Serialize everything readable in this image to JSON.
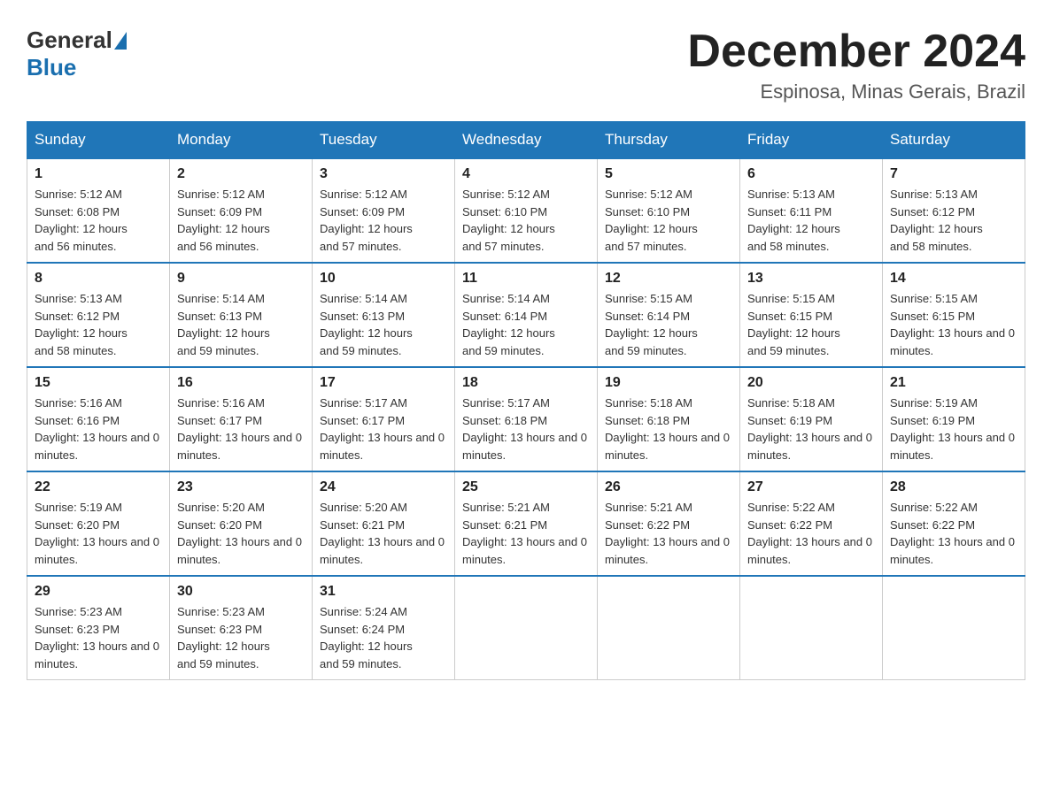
{
  "logo": {
    "general": "General",
    "blue": "Blue"
  },
  "header": {
    "month_year": "December 2024",
    "location": "Espinosa, Minas Gerais, Brazil"
  },
  "weekdays": [
    "Sunday",
    "Monday",
    "Tuesday",
    "Wednesday",
    "Thursday",
    "Friday",
    "Saturday"
  ],
  "weeks": [
    [
      {
        "day": "1",
        "sunrise": "5:12 AM",
        "sunset": "6:08 PM",
        "daylight": "12 hours and 56 minutes."
      },
      {
        "day": "2",
        "sunrise": "5:12 AM",
        "sunset": "6:09 PM",
        "daylight": "12 hours and 56 minutes."
      },
      {
        "day": "3",
        "sunrise": "5:12 AM",
        "sunset": "6:09 PM",
        "daylight": "12 hours and 57 minutes."
      },
      {
        "day": "4",
        "sunrise": "5:12 AM",
        "sunset": "6:10 PM",
        "daylight": "12 hours and 57 minutes."
      },
      {
        "day": "5",
        "sunrise": "5:12 AM",
        "sunset": "6:10 PM",
        "daylight": "12 hours and 57 minutes."
      },
      {
        "day": "6",
        "sunrise": "5:13 AM",
        "sunset": "6:11 PM",
        "daylight": "12 hours and 58 minutes."
      },
      {
        "day": "7",
        "sunrise": "5:13 AM",
        "sunset": "6:12 PM",
        "daylight": "12 hours and 58 minutes."
      }
    ],
    [
      {
        "day": "8",
        "sunrise": "5:13 AM",
        "sunset": "6:12 PM",
        "daylight": "12 hours and 58 minutes."
      },
      {
        "day": "9",
        "sunrise": "5:14 AM",
        "sunset": "6:13 PM",
        "daylight": "12 hours and 59 minutes."
      },
      {
        "day": "10",
        "sunrise": "5:14 AM",
        "sunset": "6:13 PM",
        "daylight": "12 hours and 59 minutes."
      },
      {
        "day": "11",
        "sunrise": "5:14 AM",
        "sunset": "6:14 PM",
        "daylight": "12 hours and 59 minutes."
      },
      {
        "day": "12",
        "sunrise": "5:15 AM",
        "sunset": "6:14 PM",
        "daylight": "12 hours and 59 minutes."
      },
      {
        "day": "13",
        "sunrise": "5:15 AM",
        "sunset": "6:15 PM",
        "daylight": "12 hours and 59 minutes."
      },
      {
        "day": "14",
        "sunrise": "5:15 AM",
        "sunset": "6:15 PM",
        "daylight": "13 hours and 0 minutes."
      }
    ],
    [
      {
        "day": "15",
        "sunrise": "5:16 AM",
        "sunset": "6:16 PM",
        "daylight": "13 hours and 0 minutes."
      },
      {
        "day": "16",
        "sunrise": "5:16 AM",
        "sunset": "6:17 PM",
        "daylight": "13 hours and 0 minutes."
      },
      {
        "day": "17",
        "sunrise": "5:17 AM",
        "sunset": "6:17 PM",
        "daylight": "13 hours and 0 minutes."
      },
      {
        "day": "18",
        "sunrise": "5:17 AM",
        "sunset": "6:18 PM",
        "daylight": "13 hours and 0 minutes."
      },
      {
        "day": "19",
        "sunrise": "5:18 AM",
        "sunset": "6:18 PM",
        "daylight": "13 hours and 0 minutes."
      },
      {
        "day": "20",
        "sunrise": "5:18 AM",
        "sunset": "6:19 PM",
        "daylight": "13 hours and 0 minutes."
      },
      {
        "day": "21",
        "sunrise": "5:19 AM",
        "sunset": "6:19 PM",
        "daylight": "13 hours and 0 minutes."
      }
    ],
    [
      {
        "day": "22",
        "sunrise": "5:19 AM",
        "sunset": "6:20 PM",
        "daylight": "13 hours and 0 minutes."
      },
      {
        "day": "23",
        "sunrise": "5:20 AM",
        "sunset": "6:20 PM",
        "daylight": "13 hours and 0 minutes."
      },
      {
        "day": "24",
        "sunrise": "5:20 AM",
        "sunset": "6:21 PM",
        "daylight": "13 hours and 0 minutes."
      },
      {
        "day": "25",
        "sunrise": "5:21 AM",
        "sunset": "6:21 PM",
        "daylight": "13 hours and 0 minutes."
      },
      {
        "day": "26",
        "sunrise": "5:21 AM",
        "sunset": "6:22 PM",
        "daylight": "13 hours and 0 minutes."
      },
      {
        "day": "27",
        "sunrise": "5:22 AM",
        "sunset": "6:22 PM",
        "daylight": "13 hours and 0 minutes."
      },
      {
        "day": "28",
        "sunrise": "5:22 AM",
        "sunset": "6:22 PM",
        "daylight": "13 hours and 0 minutes."
      }
    ],
    [
      {
        "day": "29",
        "sunrise": "5:23 AM",
        "sunset": "6:23 PM",
        "daylight": "13 hours and 0 minutes."
      },
      {
        "day": "30",
        "sunrise": "5:23 AM",
        "sunset": "6:23 PM",
        "daylight": "12 hours and 59 minutes."
      },
      {
        "day": "31",
        "sunrise": "5:24 AM",
        "sunset": "6:24 PM",
        "daylight": "12 hours and 59 minutes."
      },
      null,
      null,
      null,
      null
    ]
  ],
  "labels": {
    "sunrise": "Sunrise:",
    "sunset": "Sunset:",
    "daylight": "Daylight:"
  }
}
